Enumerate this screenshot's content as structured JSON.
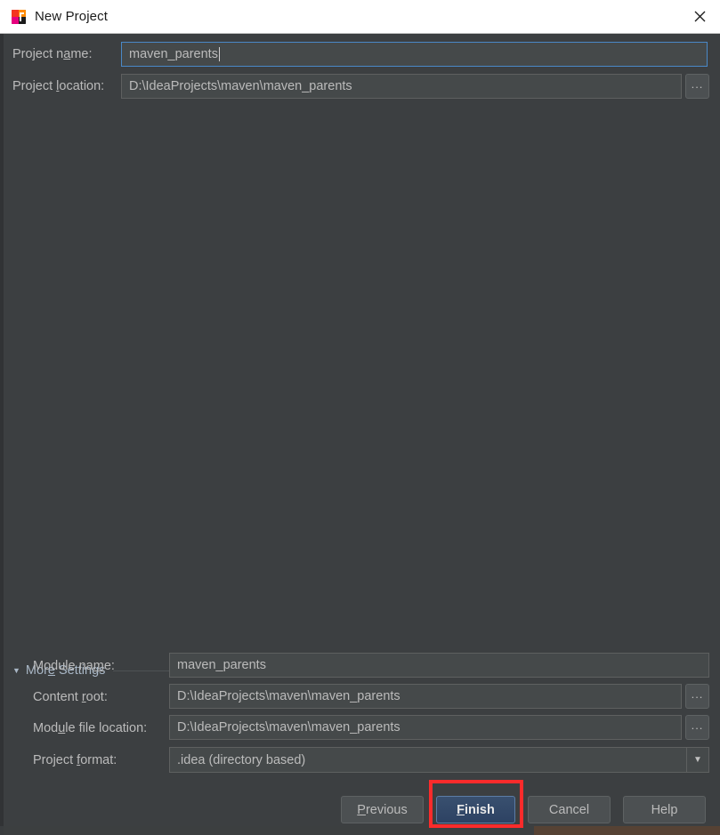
{
  "window": {
    "title": "New Project",
    "app_icon": "intellij-idea-icon",
    "close_icon": "close-icon"
  },
  "main_fields": {
    "project_name": {
      "label_pre": "Project n",
      "label_mnemonic": "a",
      "label_post": "me:",
      "value": "maven_parents",
      "focused": true
    },
    "project_location": {
      "label_pre": "Project ",
      "label_mnemonic": "l",
      "label_post": "ocation:",
      "value": "D:\\IdeaProjects\\maven\\maven_parents",
      "browse_label": "...",
      "browse_icon": "ellipsis-icon"
    }
  },
  "more_settings": {
    "triangle_icon": "chevron-down-icon",
    "label_pre": "Mor",
    "label_mnemonic": "e",
    "label_post": " Settings",
    "expanded": true,
    "fields": {
      "module_name": {
        "label_pre": "Module na",
        "label_mnemonic": "m",
        "label_post": "e:",
        "value": "maven_parents"
      },
      "content_root": {
        "label_pre": "Content ",
        "label_mnemonic": "r",
        "label_post": "oot:",
        "value": "D:\\IdeaProjects\\maven\\maven_parents",
        "browse_label": "...",
        "browse_icon": "ellipsis-icon"
      },
      "module_file_location": {
        "label_pre": "Mod",
        "label_mnemonic": "u",
        "label_post": "le file location:",
        "value": "D:\\IdeaProjects\\maven\\maven_parents",
        "browse_label": "...",
        "browse_icon": "ellipsis-icon"
      },
      "project_format": {
        "label_pre": "Project ",
        "label_mnemonic": "f",
        "label_post": "ormat:",
        "value": ".idea (directory based)",
        "arrow_icon": "chevron-down-icon"
      }
    }
  },
  "buttons": {
    "previous": {
      "pre": "",
      "mnemonic": "P",
      "post": "revious"
    },
    "finish": {
      "pre": "",
      "mnemonic": "F",
      "post": "inish",
      "is_default": true
    },
    "cancel": {
      "pre": "Cancel",
      "mnemonic": "",
      "post": ""
    },
    "help": {
      "pre": "Help",
      "mnemonic": "",
      "post": ""
    }
  },
  "annotation": {
    "highlight_color": "#fb2b2b",
    "target": "finish-button"
  },
  "colors": {
    "dialog_bg": "#3c3f41",
    "titlebar_bg": "#ffffff",
    "field_bg": "#45494a",
    "focus_border": "#4a88c7",
    "default_button_bg": "#2d4263",
    "text": "#bbbbbb",
    "accent_text": "#a9b7c6"
  }
}
